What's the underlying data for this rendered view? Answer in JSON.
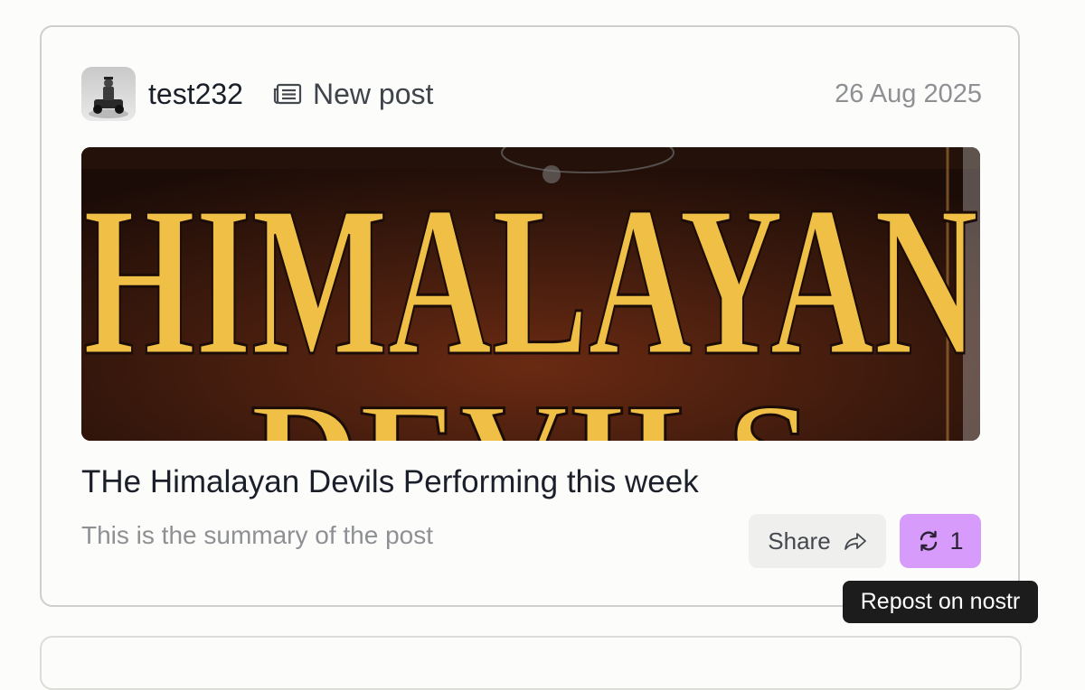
{
  "post": {
    "author": "test232",
    "type_label": "New post",
    "type_icon": "newspaper-icon",
    "date": "26 Aug 2025",
    "cover_text_line1": "HIMALAYAN",
    "cover_text_line2": "DEVILS",
    "title": "THe Himalayan Devils Performing this week",
    "summary": "This is the summary of the post"
  },
  "actions": {
    "share_label": "Share",
    "share_icon": "share-arrow-icon",
    "repost_icon": "repost-icon",
    "repost_count": "1",
    "repost_tooltip": "Repost on nostr"
  },
  "colors": {
    "repost_accent": "#d79cfb",
    "cover_lettering": "#f0bf46",
    "cover_background": "#3a1a0e"
  }
}
